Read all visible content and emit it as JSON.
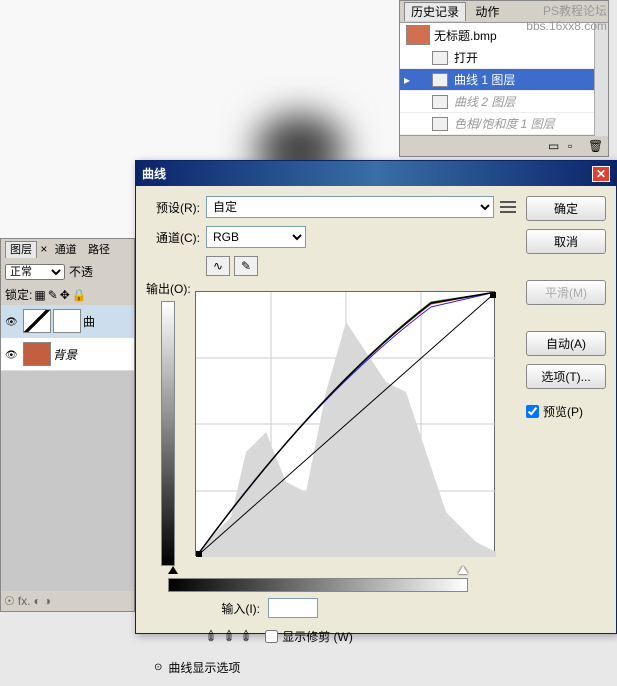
{
  "watermark": {
    "line1": "PS教程论坛",
    "line2": "bbs.16xx8.com"
  },
  "history": {
    "tabs": {
      "history": "历史记录",
      "actions": "动作"
    },
    "snapshot_label": "无标题.bmp",
    "items": [
      {
        "label": "打开",
        "selected": false,
        "dimmed": false
      },
      {
        "label": "曲线 1 图层",
        "selected": true,
        "dimmed": false
      },
      {
        "label": "曲线 2 图层",
        "selected": false,
        "dimmed": true
      },
      {
        "label": "色相/饱和度 1 图层",
        "selected": false,
        "dimmed": true
      }
    ]
  },
  "layers": {
    "tabs": {
      "layers": "图层",
      "channels": "通道",
      "paths": "路径"
    },
    "mode": "正常",
    "opacity_label": "不透",
    "lock_label": "锁定:",
    "items": [
      {
        "label": "曲",
        "selected": true,
        "type": "curves"
      },
      {
        "label": "背景",
        "selected": false,
        "type": "photo"
      }
    ],
    "footer": "fx."
  },
  "dialog": {
    "title": "曲线",
    "preset_label": "预设(R):",
    "preset_value": "自定",
    "channel_label": "通道(C):",
    "channel_value": "RGB",
    "output_label": "输出(O):",
    "input_label": "输入(I):",
    "show_clipping": "显示修剪 (W)",
    "display_options": "曲线显示选项",
    "buttons": {
      "ok": "确定",
      "cancel": "取消",
      "smooth": "平滑(M)",
      "auto": "自动(A)",
      "options": "选项(T)...",
      "preview": "预览(P)"
    }
  },
  "chart_data": {
    "type": "line",
    "title": "曲线",
    "xlabel": "输入",
    "ylabel": "输出",
    "xlim": [
      0,
      255
    ],
    "ylim": [
      0,
      255
    ],
    "series": [
      {
        "name": "baseline",
        "x": [
          0,
          255
        ],
        "y": [
          0,
          255
        ]
      },
      {
        "name": "RGB",
        "x": [
          0,
          128,
          200,
          255
        ],
        "y": [
          0,
          180,
          245,
          255
        ]
      },
      {
        "name": "R",
        "x": [
          0,
          128,
          200,
          255
        ],
        "y": [
          0,
          175,
          242,
          255
        ]
      },
      {
        "name": "G",
        "x": [
          0,
          128,
          200,
          255
        ],
        "y": [
          0,
          183,
          246,
          255
        ]
      },
      {
        "name": "B",
        "x": [
          0,
          128,
          200,
          255
        ],
        "y": [
          0,
          170,
          240,
          255
        ]
      }
    ],
    "histogram_peaks_x": [
      30,
      60,
      90,
      150,
      200
    ],
    "histogram_peaks_y": [
      40,
      120,
      80,
      230,
      160
    ]
  }
}
